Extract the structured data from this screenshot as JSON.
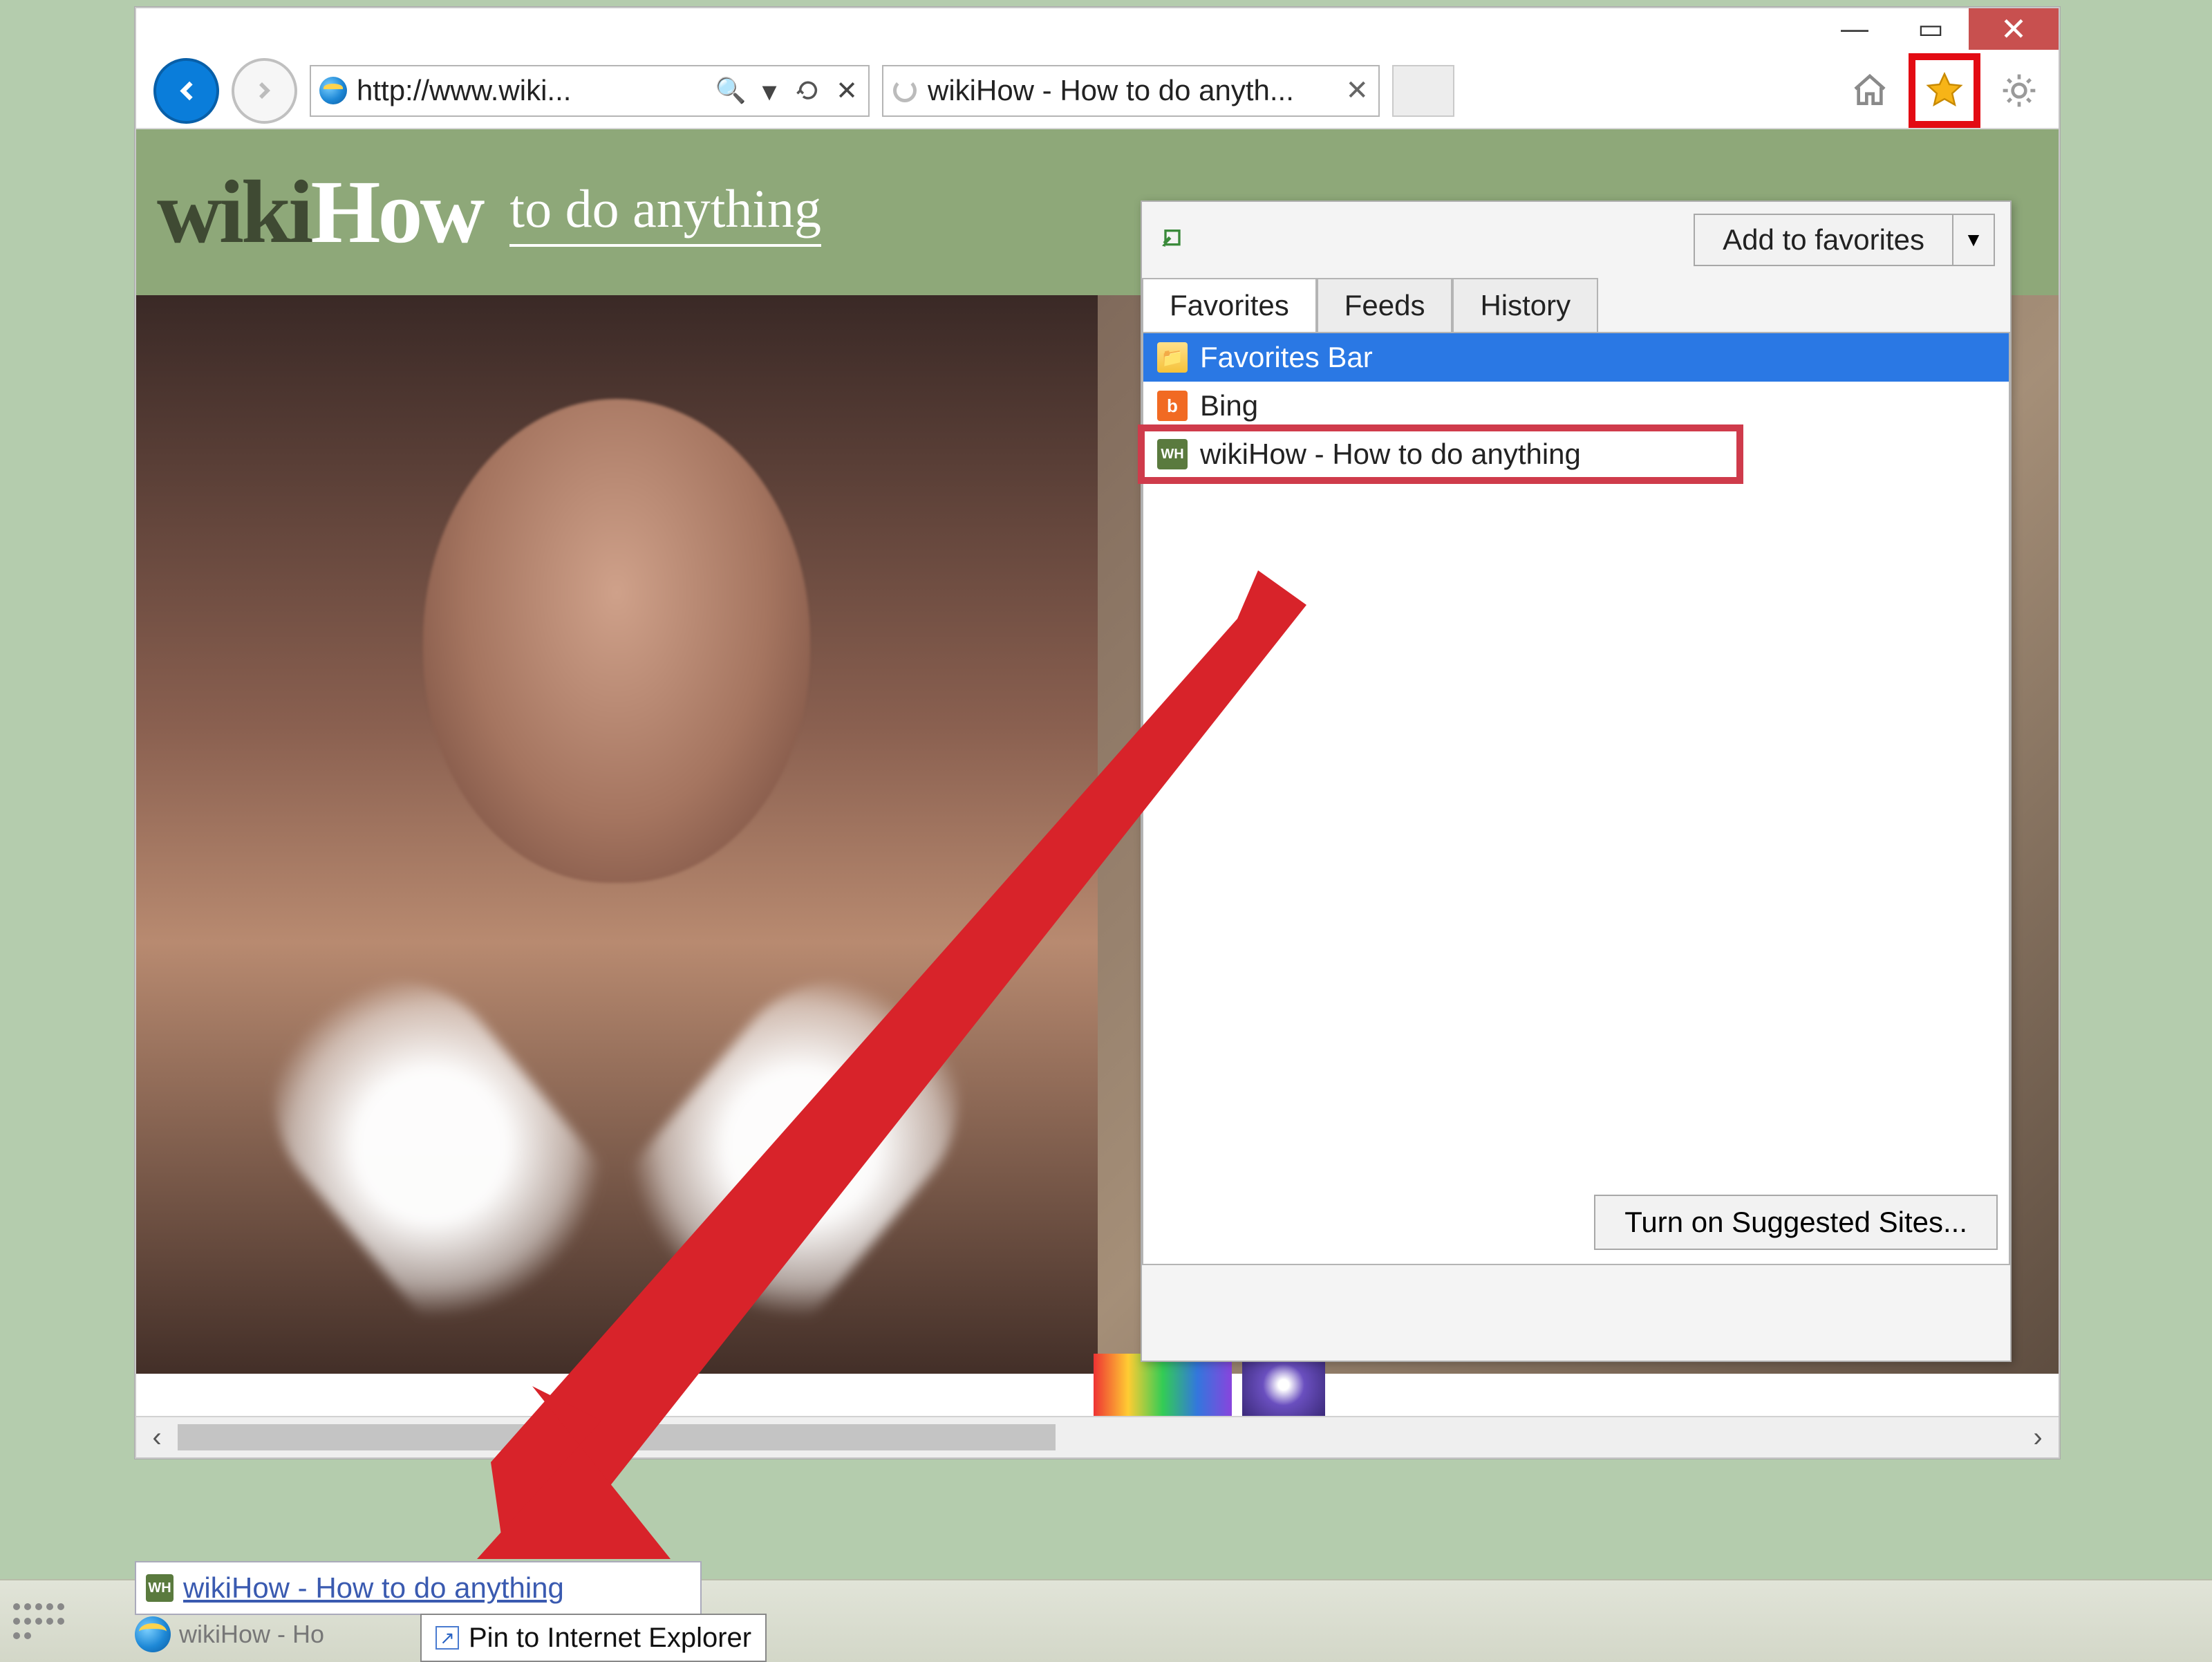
{
  "window_controls": {
    "min": "—",
    "max": "▭",
    "close": "✕"
  },
  "toolbar": {
    "url": "http://www.wiki...",
    "tab_title": "wikiHow - How to do anyth...",
    "search_glyph": "🔍",
    "dropdown_glyph": "▾",
    "refresh_glyph": "⟳",
    "stop_glyph": "✕"
  },
  "page_content": {
    "logo_wiki": "wiki",
    "logo_how": "How",
    "tagline": "to do anything"
  },
  "favorites_panel": {
    "add_button": "Add to favorites",
    "tabs": [
      "Favorites",
      "Feeds",
      "History"
    ],
    "items": [
      {
        "icon": "folder",
        "label": "Favorites Bar",
        "selected": true
      },
      {
        "icon": "bing",
        "glyph": "b",
        "label": "Bing"
      },
      {
        "icon": "wh",
        "glyph": "WH",
        "label": "wikiHow - How to do anything",
        "highlight": true
      }
    ],
    "suggested_button": "Turn on Suggested Sites..."
  },
  "taskbar": {
    "drag_item": "wikiHow - How to do anything",
    "ie_label": "wikiHow - Ho",
    "pin_popup": "Pin to Internet Explorer",
    "pin_arrow": "↗"
  },
  "scrollbar": {
    "left": "‹",
    "right": "›"
  }
}
